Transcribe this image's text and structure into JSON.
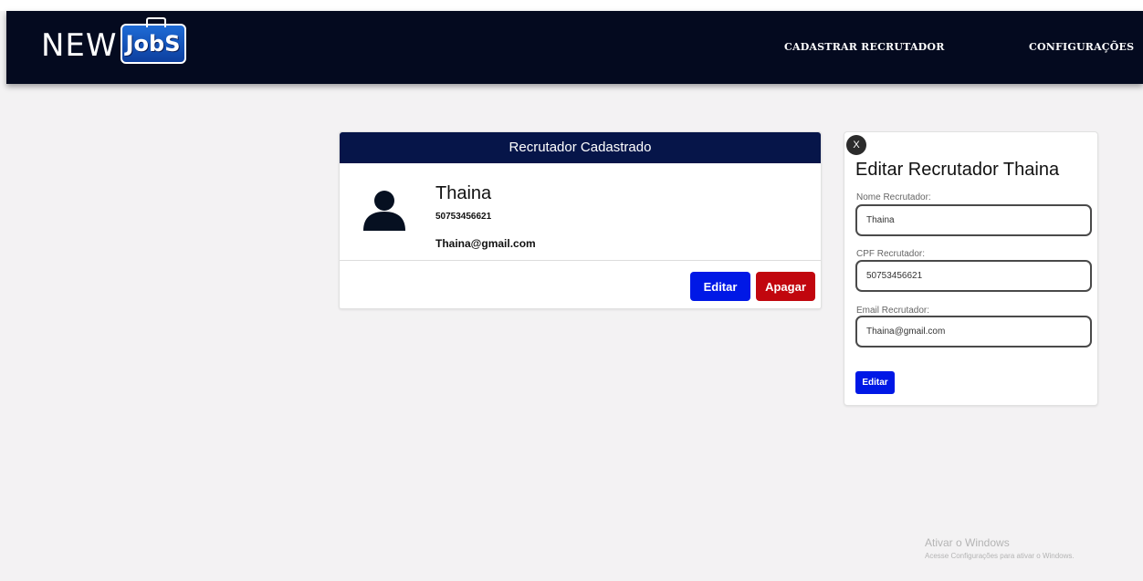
{
  "navbar": {
    "logo_new": "NEW",
    "logo_jobs": "JobS",
    "links": [
      {
        "label": "CADASTRAR RECRUTADOR"
      },
      {
        "label": "CONFIGURAÇÕES"
      }
    ]
  },
  "card": {
    "header": "Recrutador Cadastrado",
    "name": "Thaina",
    "cpf": "50753456621",
    "email": "Thaina@gmail.com",
    "edit_label": "Editar",
    "delete_label": "Apagar",
    "icon": "user-icon"
  },
  "edit_panel": {
    "close_label": "X",
    "title": "Editar Recrutador Thaina",
    "fields": {
      "name": {
        "label": "Nome Recrutador:",
        "value": "Thaina"
      },
      "cpf": {
        "label": "CPF Recrutador:",
        "value": "50753456621"
      },
      "email": {
        "label": "Email Recrutador:",
        "value": "Thaina@gmail.com"
      }
    },
    "submit_label": "Editar"
  },
  "watermark": {
    "line1": "Ativar o Windows",
    "line2": "Acesse Configurações para ativar o Windows."
  },
  "colors": {
    "navbar": "#040a1f",
    "card_header": "#061549",
    "edit_button": "#0018e6",
    "delete_button": "#c1060e",
    "background": "#f3f2f3"
  }
}
